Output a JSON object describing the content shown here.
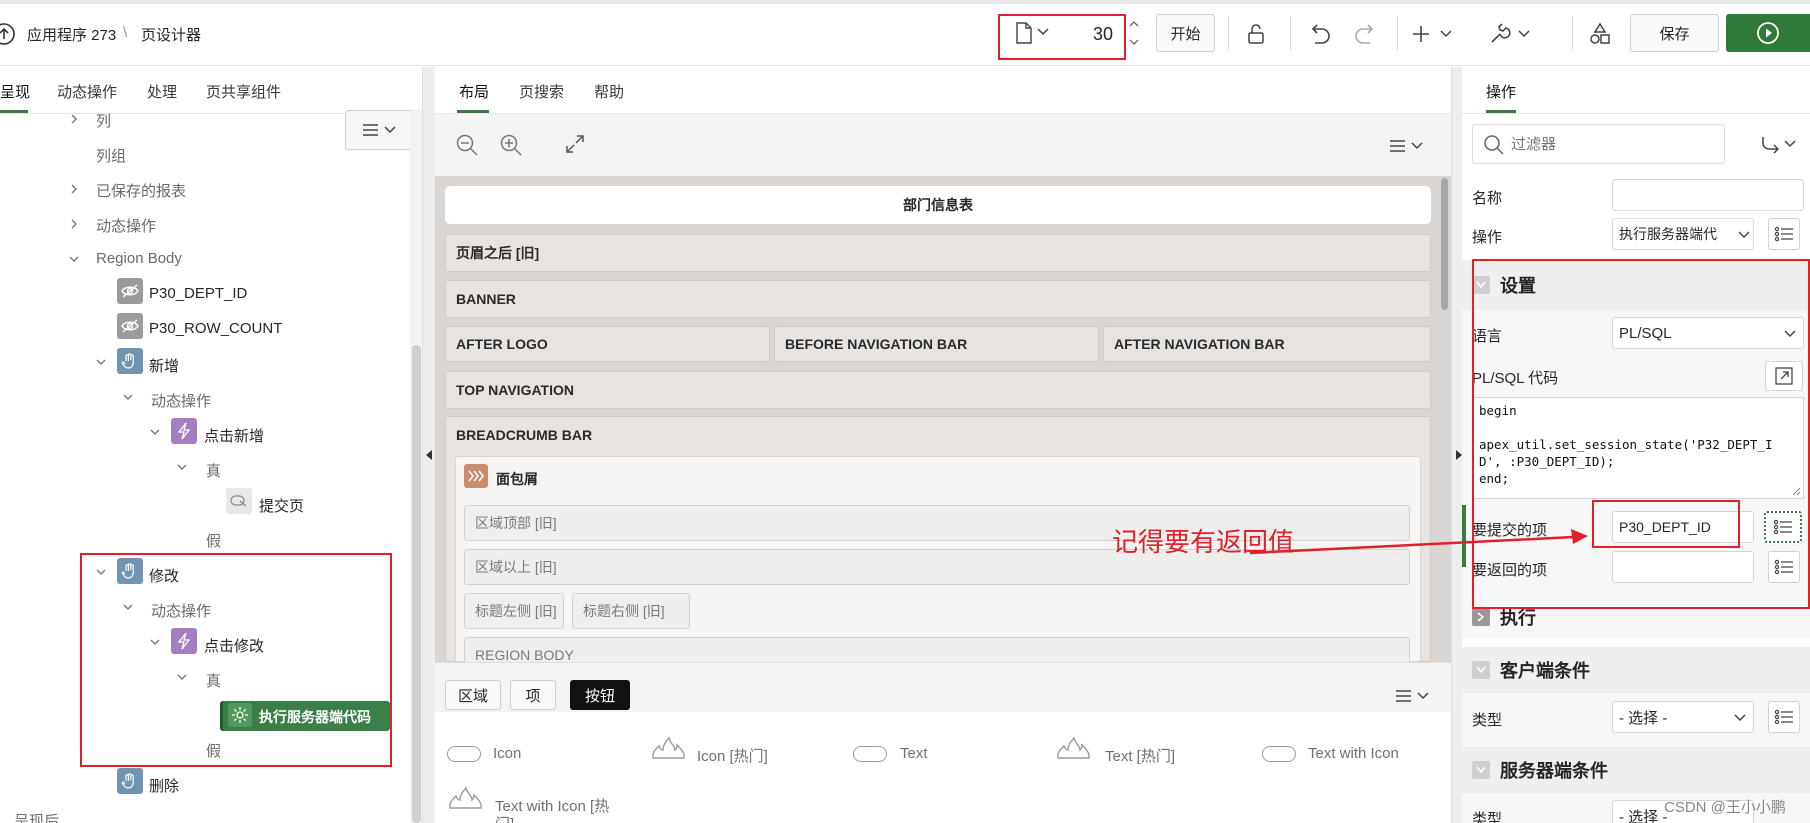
{
  "header": {
    "app_label": "应用程序 273",
    "separator": "\\",
    "page_designer": "页设计器",
    "page_number": "30",
    "go_button": "开始",
    "save_button": "保存"
  },
  "left_panel": {
    "tabs": [
      "呈现",
      "动态操作",
      "处理",
      "页共享组件"
    ],
    "tree": {
      "columns": "列",
      "column_groups": "列组",
      "saved_reports": "已保存的报表",
      "dynamic_actions": "动态操作",
      "region_body": "Region Body",
      "item_dept_id": "P30_DEPT_ID",
      "item_row_count": "P30_ROW_COUNT",
      "btn_add": "新增",
      "add_dynamic_actions": "动态操作",
      "add_click": "点击新增",
      "add_true": "真",
      "add_submit": "提交页",
      "add_false": "假",
      "btn_edit": "修改",
      "edit_dynamic_actions": "动态操作",
      "edit_click": "点击修改",
      "edit_true": "真",
      "edit_exec": "执行服务器端代码",
      "edit_false": "假",
      "btn_delete": "删除",
      "after_render": "呈现后"
    }
  },
  "middle_panel": {
    "tabs": [
      "布局",
      "页搜索",
      "帮助"
    ],
    "page_title": "部门信息表",
    "bands": {
      "after_header": "页眉之后 [旧]",
      "banner": "BANNER",
      "after_logo": "AFTER LOGO",
      "before_nav": "BEFORE NAVIGATION BAR",
      "after_nav": "AFTER NAVIGATION BAR",
      "top_nav": "TOP NAVIGATION",
      "breadcrumb_bar": "BREADCRUMB BAR",
      "breadcrumb": "面包屑",
      "region_top": "区域顶部 [旧]",
      "region_above": "区域以上 [旧]",
      "title_left": "标题左侧 [旧]",
      "title_right": "标题右侧 [旧]",
      "region_body": "REGION BODY"
    },
    "gallery_tabs": [
      "区域",
      "项",
      "按钮"
    ],
    "gallery_items": [
      "Icon",
      "Icon [热门]",
      "Text",
      "Text [热门]",
      "Text with Icon",
      "Text with Icon [热",
      "门]"
    ]
  },
  "right_panel": {
    "tab": "操作",
    "filter_placeholder": "过滤器",
    "name_label": "名称",
    "name_value": "",
    "action_label": "操作",
    "action_value": "执行服务器端代",
    "settings_section": "设置",
    "language_label": "语言",
    "language_value": "PL/SQL",
    "code_label": "PL/SQL 代码",
    "code_lines": [
      "begin",
      "",
      "apex_util.set_session_state('P32_DEPT_I",
      "D', :P30_DEPT_ID);",
      "end;"
    ],
    "submit_label": "要提交的项",
    "submit_value": "P30_DEPT_ID",
    "return_label": "要返回的项",
    "return_value": "",
    "execute_section": "执行",
    "client_section": "客户端条件",
    "client_type_label": "类型",
    "client_type_value": "- 选择 -",
    "server_section": "服务器端条件",
    "server_type_label": "类型",
    "server_type_value": "- 选择 -"
  },
  "annotation": {
    "note": "记得要有返回值"
  },
  "watermark": "CSDN @王小小鹏",
  "colors": {
    "accent": "#3c7a43",
    "annotation_red": "#e0202a",
    "canvas": "#d8d5d2"
  }
}
